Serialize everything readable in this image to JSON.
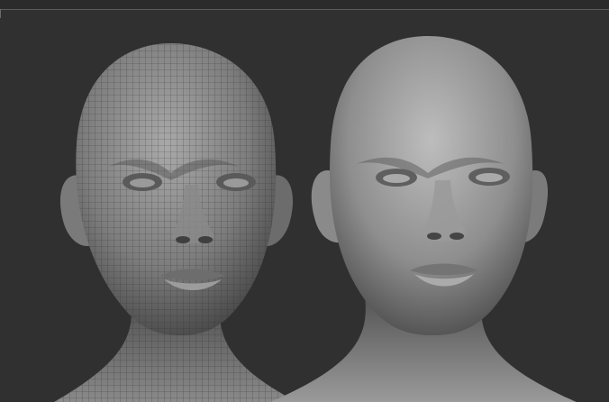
{
  "scene": {
    "background_color": "#303030",
    "rule_color": "#5c5c5c",
    "views": [
      {
        "id": "wireframe-head",
        "shading": "wireframe-clay"
      },
      {
        "id": "smooth-head",
        "shading": "smooth-clay"
      }
    ]
  }
}
